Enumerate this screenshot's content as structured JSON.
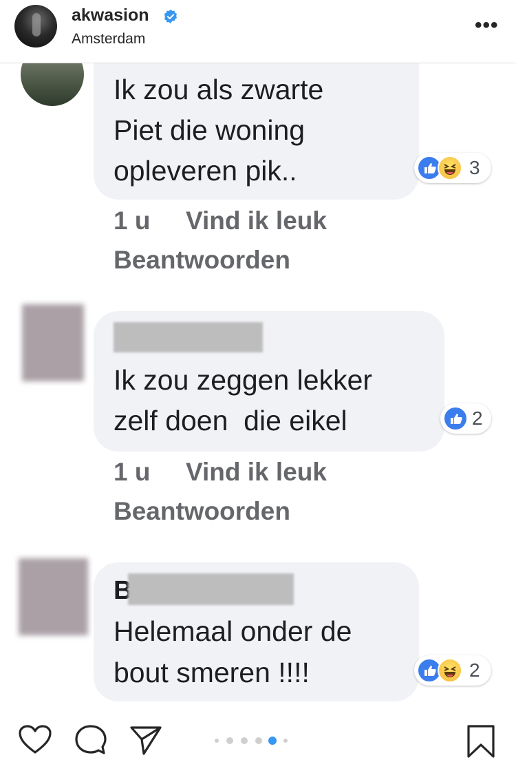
{
  "header": {
    "username": "akwasion",
    "location": "Amsterdam",
    "more_label": "•••"
  },
  "comments": [
    {
      "lines": [
        "Ik zou als zwarte",
        "Piet die woning",
        "opleveren pik.."
      ],
      "reaction_count": "3",
      "time": "1 u",
      "like_label": "Vind ik leuk",
      "reply_label": "Beantwoorden"
    },
    {
      "lines": [
        "Ik zou zeggen lekker",
        "zelf doen  die eikel"
      ],
      "reaction_count": "2",
      "time": "1 u",
      "like_label": "Vind ik leuk",
      "reply_label": "Beantwoorden"
    },
    {
      "name_initial": "B",
      "lines": [
        "Helemaal onder de",
        "bout smeren !!!!"
      ],
      "reaction_count": "2"
    }
  ],
  "carousel": {
    "count": 6,
    "active_index": 3
  },
  "colors": {
    "accent": "#3897f0",
    "bubble": "#f1f2f6",
    "like": "#3b7ded"
  }
}
